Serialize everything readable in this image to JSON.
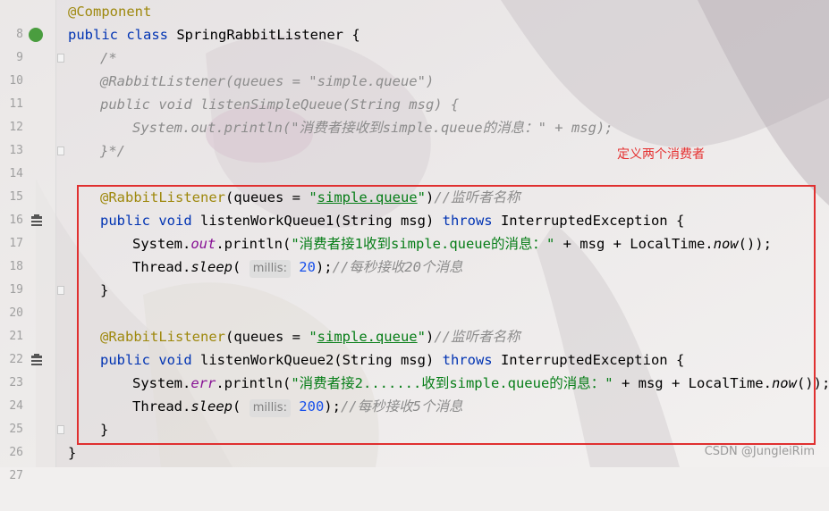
{
  "editor": {
    "lines": [
      {
        "n": "8"
      },
      {
        "n": "9"
      },
      {
        "n": "10"
      },
      {
        "n": "11"
      },
      {
        "n": "12"
      },
      {
        "n": "13"
      },
      {
        "n": "14"
      },
      {
        "n": "15"
      },
      {
        "n": "16"
      },
      {
        "n": "17"
      },
      {
        "n": "18"
      },
      {
        "n": "19"
      },
      {
        "n": "20"
      },
      {
        "n": "21"
      },
      {
        "n": "22"
      },
      {
        "n": "23"
      },
      {
        "n": "24"
      },
      {
        "n": "25"
      },
      {
        "n": "26"
      },
      {
        "n": "27"
      }
    ],
    "code": {
      "l8_ann": "@Component",
      "l9_public": "public",
      "l9_class": "class",
      "l9_name": " SpringRabbitListener {",
      "l10": "/*",
      "l11": "@RabbitListener(queues = \"simple.queue\")",
      "l12": "public void listenSimpleQueue(String msg) {",
      "l13": "System.out.println(\"消费者接收到simple.queue的消息：\" + msg);",
      "l14": "}*/",
      "l16_ann": "@RabbitListener",
      "l16_a": "(queues = ",
      "l16_q1": "\"",
      "l16_str": "simple.queue",
      "l16_q2": "\"",
      "l16_b": ")",
      "l16_cmt": "//监听者名称",
      "l17_public": "public",
      "l17_void": "void",
      "l17_a": " listenWorkQueue1(String msg) ",
      "l17_throws": "throws",
      "l17_b": " InterruptedException {",
      "l18_a": "System.",
      "l18_field": "out",
      "l18_b": ".println(",
      "l18_str": "\"消费者接1收到simple.queue的消息：\"",
      "l18_c": " + msg + LocalTime.",
      "l18_now": "now",
      "l18_d": "());",
      "l19_a": "Thread.",
      "l19_sleep": "sleep",
      "l19_b": "(",
      "l19_hint": "millis:",
      "l19_num": "20",
      "l19_c": ");",
      "l19_cmt": "//每秒接收20个消息",
      "l20": "}",
      "l22_ann": "@RabbitListener",
      "l22_a": "(queues = ",
      "l22_q1": "\"",
      "l22_str": "simple.queue",
      "l22_q2": "\"",
      "l22_b": ")",
      "l22_cmt": "//监听者名称",
      "l23_public": "public",
      "l23_void": "void",
      "l23_a": " listenWorkQueue2(String msg) ",
      "l23_throws": "throws",
      "l23_b": " InterruptedException {",
      "l24_a": "System.",
      "l24_field": "err",
      "l24_b": ".println(",
      "l24_str": "\"消费者接2.......收到simple.queue的消息：\"",
      "l24_c": " + msg + LocalTime.",
      "l24_now": "now",
      "l24_d": "());",
      "l25_a": "Thread.",
      "l25_sleep": "sleep",
      "l25_b": "(",
      "l25_hint": "millis:",
      "l25_num": "200",
      "l25_c": ");",
      "l25_cmt": "//每秒接收5个消息",
      "l26": "}",
      "l27": "}"
    }
  },
  "annotation": {
    "note": "定义两个消费者",
    "box_color": "#e03030"
  },
  "watermark": "CSDN @JungleiRim",
  "icons": {
    "bean": "spring-bean-icon",
    "run": "run-method-icon"
  }
}
